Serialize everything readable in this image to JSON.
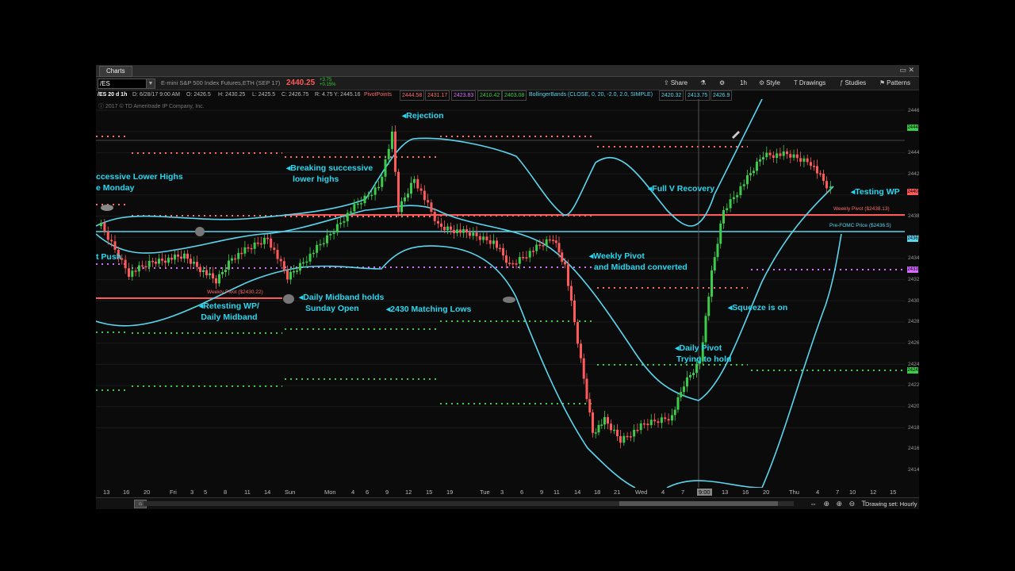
{
  "window": {
    "tab": "Charts",
    "buttons": "▭  ✕"
  },
  "toolbar": {
    "symbol": "/ES",
    "description": "E-mini S&P 500 Index Futures,ETH (SEP 17)",
    "last_price": "2440.25",
    "change_line1": "+3.75",
    "change_line2": "+0.15%",
    "share_label": "Share",
    "timeframe": "1h",
    "style_label": "Style",
    "drawings_label": "Drawings",
    "studies_label": "Studies",
    "patterns_label": "Patterns"
  },
  "studybar": {
    "period": "/ES 20 d 1h",
    "date": "D: 6/28/17 9:00 AM",
    "open": "O: 2426.5",
    "high": "H: 2430.25",
    "low": "L: 2425.5",
    "close": "C: 2426.75",
    "range": "R: 4.75",
    "y": "Y: 2445.16",
    "pivot_name": "PivotPoints",
    "pivot_values": [
      "2444.58",
      "2431.17",
      "2423.83",
      "2410.42",
      "2403.08"
    ],
    "bb_name": "BollingerBands (CLOSE, 0, 20, -2.0, 2.0, SIMPLE)",
    "bb_values": [
      "2420.32",
      "2413.75",
      "2426.9"
    ],
    "colors": {
      "pivot_r": "#ff6b6b",
      "pivot_p": "#d86bff",
      "pivot_s": "#3ccc4a",
      "bb": "#5ad6ee"
    }
  },
  "copyright": "2017 © TD Ameritrade IP Company, Inc.",
  "annotations": {
    "rejection": "Rejection",
    "lower_highs_1": "ccessive Lower Highs",
    "lower_highs_2": "e Monday",
    "breaking_1": "Breaking successive",
    "breaking_2": "lower highs",
    "full_v": "Full V Recovery",
    "testing_wp": "Testing WP",
    "t_push": "t Push",
    "weekly_pivot_1": "Weekly Pivot",
    "weekly_pivot_2": "and Midband converted",
    "retesting_1": "Retesting WP/",
    "retesting_2": "Daily Midband",
    "daily_mid_1": "Daily Midband holds",
    "daily_mid_2": "Sunday Open",
    "matching_lows": "2430 Matching Lows",
    "squeeze": "Squeeze is on",
    "daily_pivot_1": "Daily Pivot",
    "daily_pivot_2": "Trying to hold"
  },
  "level_labels": {
    "weekly_pivot": "Weekly Pivot ($2438.13)",
    "pre_fomc": "Pre-FOMC Price ($2436.5)",
    "old_weekly_pivot": "Weekly Pivot ($2430.22)"
  },
  "y_axis_ticks": [
    "2446",
    "2444",
    "2442",
    "2438",
    "2436",
    "2434",
    "2432",
    "2430",
    "2428",
    "2426",
    "2424",
    "2422",
    "2420",
    "2418",
    "2416",
    "2414"
  ],
  "right_tags": [
    "2444",
    "2440",
    "2436",
    "2433",
    "2424"
  ],
  "x_axis_labels": [
    "13",
    "16",
    "20",
    "Fri",
    "3",
    "5",
    "8",
    "11",
    "14",
    "Sun",
    "Mon",
    "4",
    "6",
    "9",
    "12",
    "15",
    "19",
    "Tue",
    "3",
    "6",
    "9",
    "11",
    "14",
    "18",
    "21",
    "Wed",
    "4",
    "7",
    "9:00",
    "13",
    "16",
    "20",
    "Thu",
    "4",
    "7",
    "10",
    "12",
    "15"
  ],
  "bottom": {
    "home": "⌂",
    "zoom_icons": "⇔ ⊕ ⊕ ⊖ T",
    "drawing_set": "Drawing set: Hourly"
  }
}
